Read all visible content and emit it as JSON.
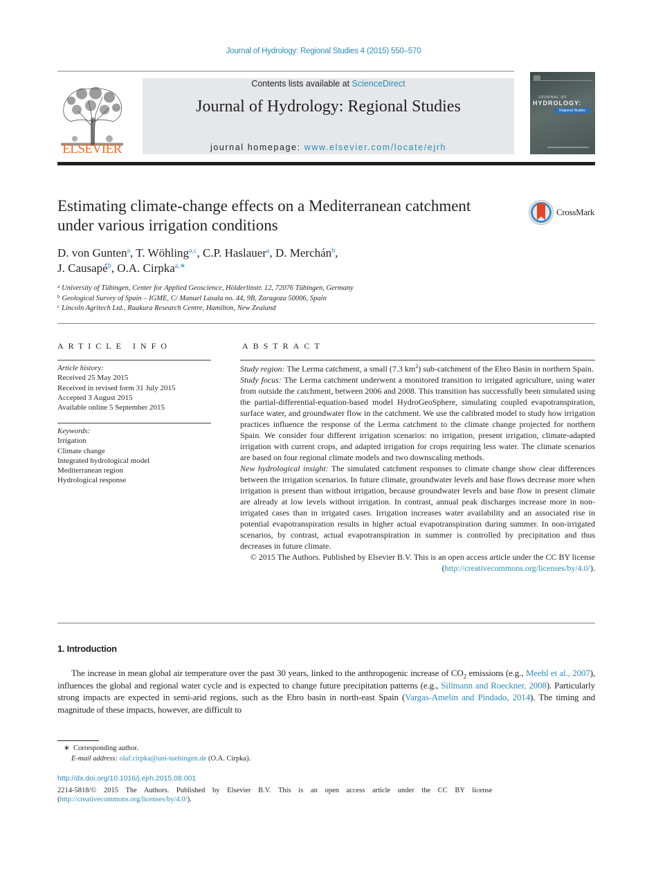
{
  "running_head": "Journal of Hydrology: Regional Studies 4 (2015) 550–570",
  "masthead": {
    "publisher_logo_word": "ELSEVIER",
    "contents_prefix": "Contents lists available at ",
    "contents_link": "ScienceDirect",
    "journal_title": "Journal of Hydrology: Regional Studies",
    "homepage_prefix": "journal homepage: ",
    "homepage_link": "www.elsevier.com/locate/ejrh",
    "cover": {
      "line1": "JOURNAL OF",
      "line2": "HYDROLOGY:",
      "line3": "Regional Studies"
    }
  },
  "article": {
    "title": "Estimating climate-change effects on a Mediterranean catchment under various irrigation conditions",
    "crossmark_label": "CrossMark",
    "authors": [
      {
        "name": "D. von Gunten",
        "aff": "a",
        "sep": ", "
      },
      {
        "name": "T. Wöhling",
        "aff": "a,c",
        "sep": ", "
      },
      {
        "name": "C.P. Haslauer",
        "aff": "a",
        "sep": ", "
      },
      {
        "name": "D. Merchán",
        "aff": "b",
        "sep": ","
      },
      {
        "name": "J. Causapé",
        "aff": "b",
        "sep": ", "
      },
      {
        "name": "O.A. Cirpka",
        "aff": "a,∗",
        "sep": ""
      }
    ],
    "affiliations": [
      {
        "key": "a",
        "text": "University of Tübingen, Center for Applied Geoscience, Hölderlinstr. 12, 72076 Tübingen, Germany"
      },
      {
        "key": "b",
        "text": "Geological Survey of Spain – IGME, C/ Manuel Lasala no. 44, 9B, Zaragoza 50006, Spain"
      },
      {
        "key": "c",
        "text": "Lincoln Agritech Ltd., Ruakura Research Centre, Hamilton, New Zealand"
      }
    ]
  },
  "article_info": {
    "heading": "ARTICLE INFO",
    "history_label": "Article history:",
    "history": [
      "Received 25 May 2015",
      "Received in revised form 31 July 2015",
      "Accepted 3 August 2015",
      "Available online 5 September 2015"
    ],
    "keywords_label": "Keywords:",
    "keywords": [
      "Irrigation",
      "Climate change",
      "Integrated hydrological model",
      "Mediterranean region",
      "Hydrological response"
    ]
  },
  "abstract": {
    "heading": "ABSTRACT",
    "study_region_label": "Study region:",
    "study_region_text_1": " The Lerma catchment, a small (7.3 km",
    "study_region_sup": "2",
    "study_region_text_2": ") sub-catchment of the Ebro Basin in northern Spain.",
    "study_focus_label": "Study focus:",
    "study_focus_text": " The Lerma catchment underwent a monitored transition to irrigated agriculture, using water from outside the catchment, between 2006 and 2008. This transition has successfully been simulated using the partial-differential-equation-based model HydroGeoSphere, simulating coupled evapotranspiration, surface water, and groundwater flow in the catchment. We use the calibrated model to study how irrigation practices influence the response of the Lerma catchment to the climate change projected for northern Spain. We consider four different irrigation scenarios: no irrigation, present irrigation, climate-adapted irrigation with current crops, and adapted irrigation for crops requiring less water. The climate scenarios are based on four regional climate models and two downscaling methods.",
    "insight_label": "New hydrological insight:",
    "insight_text": " The simulated catchment responses to climate change show clear differences between the irrigation scenarios. In future climate, groundwater levels and base flows decrease more when irrigation is present than without irrigation, because groundwater levels and base flow in present climate are already at low levels without irrigation. In contrast, annual peak discharges increase more in non-irrigated cases than in irrigated cases. Irrigation increases water availability and an associated rise in potential evapotranspiration results in higher actual evapotranspiration during summer. In non-irrigated scenarios, by contrast, actual evapotranspiration in summer is controlled by precipitation and thus decreases in future climate.",
    "copyright_text": "© 2015 The Authors. Published by Elsevier B.V. This is an open access article under the CC BY license (",
    "copyright_link": "http://creativecommons.org/licenses/by/4.0/",
    "copyright_end": ")."
  },
  "introduction": {
    "heading": "1.  Introduction",
    "p1_a": "The increase in mean global air temperature over the past 30 years, linked to the anthropogenic increase of CO",
    "p1_sub": "2",
    "p1_b": " emissions (e.g., ",
    "cite1": "Meehl et al., 2007",
    "p1_c": "), influences the global and regional water cycle and is expected to change future precipitation patterns (e.g., ",
    "cite2": "Sillmann and Roeckner, 2008",
    "p1_d": "). Particularly strong impacts are expected in semi-arid regions, such as the Ebro basin in north-east Spain (",
    "cite3": "Vargas-Amelin and Pindado, 2014",
    "p1_e": "). The timing and magnitude of these impacts, however, are difficult to"
  },
  "footnotes": {
    "corresponding_mark": "∗",
    "corresponding_text": "Corresponding author.",
    "email_label": "E-mail address:",
    "email": "olaf.cirpka@uni-tuebingen.de",
    "email_owner": " (O.A. Cirpka).",
    "doi": "http://dx.doi.org/10.1016/j.ejrh.2015.08.001",
    "license_text": "2214-5818/© 2015 The Authors. Published by Elsevier B.V. This is an open access article under the CC BY license",
    "license_link": "http://creativecommons.org/licenses/by/4.0/",
    "license_open": "(",
    "license_close": ")."
  },
  "colors": {
    "link": "#2a8bb8",
    "elsevier_orange": "#f36d21",
    "masthead_gray": "#e6e7e8",
    "text": "#231f20"
  }
}
